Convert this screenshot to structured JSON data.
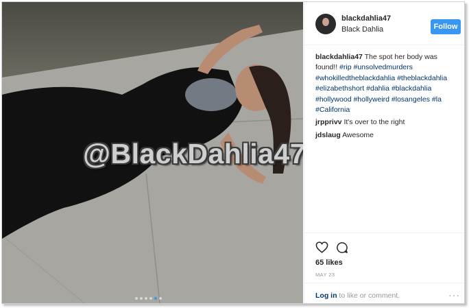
{
  "post": {
    "username": "blackdahlia47",
    "location": "Black Dahlia",
    "follow_label": "Follow",
    "watermark": "@BlackDahlia47",
    "caption_text": "The spot her body was found!!",
    "hashtags": [
      "#rip",
      "#unsolvedmurders",
      "#whokilledtheblackdahlia",
      "#theblackdahlia",
      "#elizabethshort",
      "#dahlia",
      "#blackdahlia",
      "#hollywood",
      "#hollyweird",
      "#losangeles",
      "#la",
      "#California"
    ],
    "comments": [
      {
        "user": "jrpprivv",
        "text": "It's over to the right"
      },
      {
        "user": "jdslaug",
        "text": "Awesome"
      }
    ],
    "likes": "65 likes",
    "date": "MAY 23",
    "login_link": "Log in",
    "login_rest": "to like or comment.",
    "more_label": "···",
    "carousel_dots": 6,
    "active_dot": 5
  },
  "colors": {
    "accent": "#3897f0",
    "hashtag": "#003569",
    "text": "#262626"
  },
  "icons": [
    "heart-icon",
    "comment-icon"
  ]
}
